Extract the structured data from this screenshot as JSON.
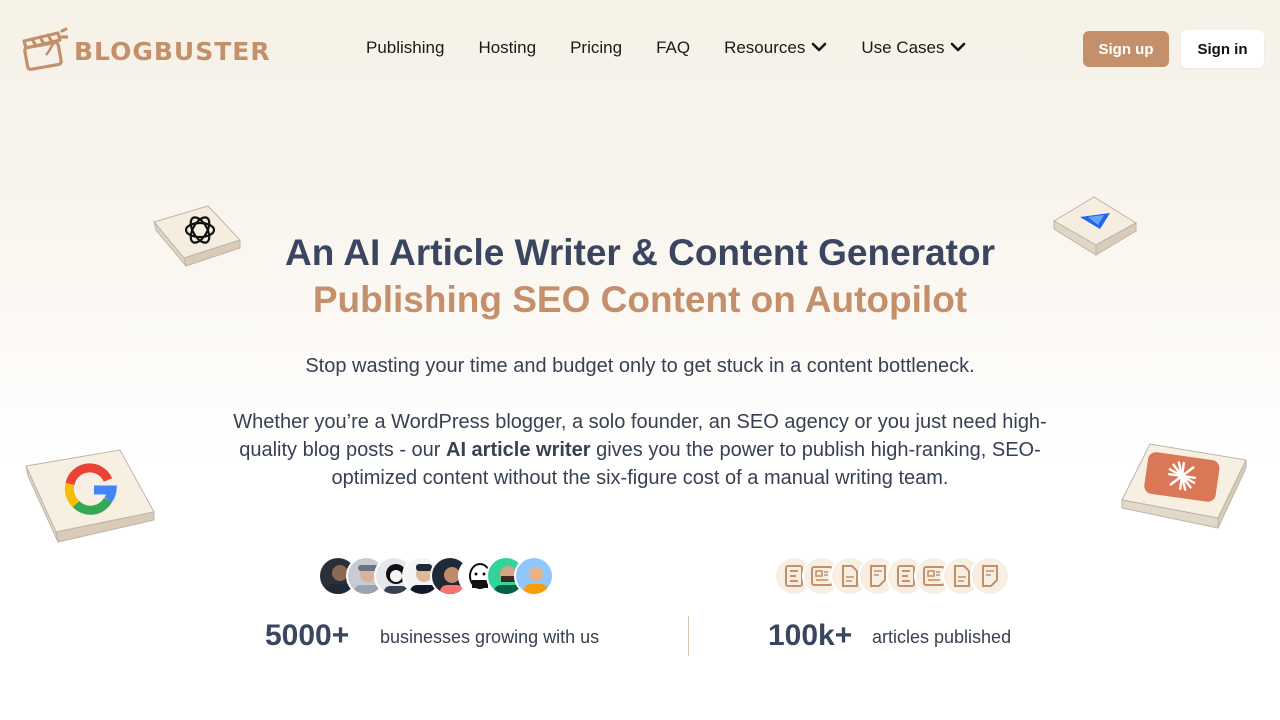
{
  "header": {
    "logo_text": "BLOGBUSTER",
    "nav": [
      {
        "label": "Publishing",
        "has_dropdown": false
      },
      {
        "label": "Hosting",
        "has_dropdown": false
      },
      {
        "label": "Pricing",
        "has_dropdown": false
      },
      {
        "label": "FAQ",
        "has_dropdown": false
      },
      {
        "label": "Resources",
        "has_dropdown": true
      },
      {
        "label": "Use Cases",
        "has_dropdown": true
      }
    ],
    "signup_label": "Sign up",
    "signin_label": "Sign in"
  },
  "hero": {
    "title": "An AI Article Writer & Content Generator",
    "subtitle": "Publishing SEO Content on Autopilot",
    "p1": "Stop wasting your time and budget only to get stuck in a content bottleneck.",
    "p2_before": "Whether you’re a WordPress blogger, a solo founder, an SEO agency or you just need high-quality blog posts - our ",
    "p2_bold": "AI article writer",
    "p2_after": " gives you the power to publish high-ranking, SEO-optimized content without the six-figure cost of a manual writing team."
  },
  "tiles": [
    "openai-logo",
    "gemini-logo",
    "google-logo",
    "claude-logo"
  ],
  "stats": {
    "businesses_num": "5000+",
    "businesses_label": "businesses growing with us",
    "articles_num": "100k+",
    "articles_label": "articles published"
  },
  "colors": {
    "accent": "#c4906b",
    "heading": "#3a4560",
    "text": "#374151"
  }
}
